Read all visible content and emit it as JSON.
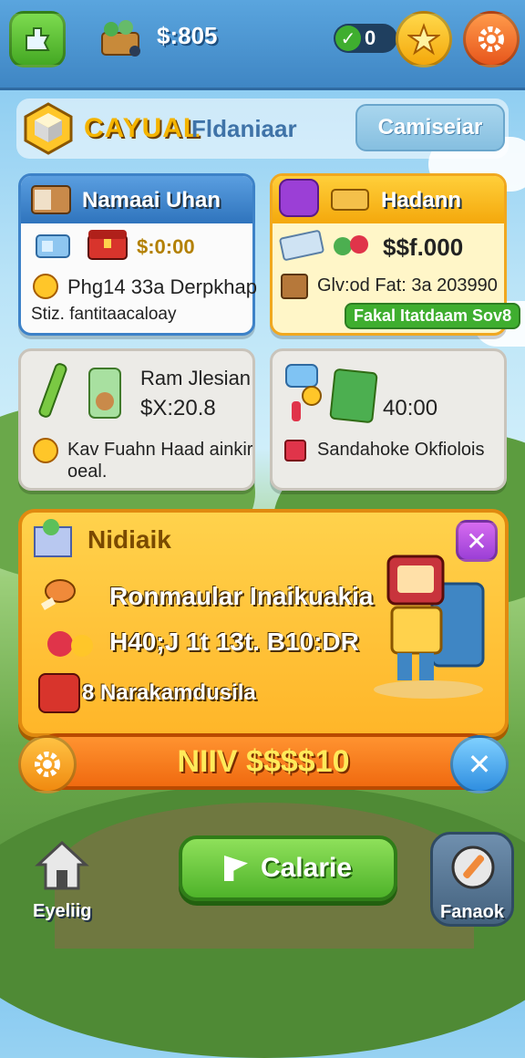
{
  "top_bar": {
    "currency": "$:805",
    "counter": "0"
  },
  "header": {
    "title": "CAYUAL",
    "subtitle": "Fldaniaar",
    "action_label": "Camiseiar"
  },
  "cards": [
    {
      "title": "Namaai Uhan",
      "value": "$:0:00",
      "line1": "Phg14 33a Derpkhap",
      "line2": "Stiz. fantitaacaloay"
    },
    {
      "title": "Hadann",
      "value": "$$f.000",
      "line1": "Glv:od Fat: 3a 203990",
      "tag": "Fakal Itatdaam Sov8"
    },
    {
      "title": "Ram Jlesian",
      "value": "$X:20.8",
      "line1": "Kav Fuahn Haad ainkir",
      "line2": "oeal."
    },
    {
      "title": "",
      "value": "40:00",
      "line1": "Sandahoke Okfiolois"
    }
  ],
  "promo": {
    "title": "Nidiaik",
    "lines": [
      "Ronmaular Inaikuakia",
      "H40;J 1t 13t. B10:DR",
      "8 Narakamdusila"
    ],
    "buy_label": "NIIV $$$$10"
  },
  "bottom_nav": {
    "left_label": "Eyeliig",
    "center_label": "Calarie",
    "right_label": "Fanaok"
  },
  "colors": {
    "top_bar": "#3f86c4",
    "accent_yellow": "#ffc629",
    "accent_orange": "#f06a10",
    "accent_green": "#4fb32a",
    "card_blue_border": "#3d82c8"
  },
  "icons": [
    "star-icon",
    "gear-icon",
    "close-icon",
    "home-icon",
    "pencil-icon",
    "check-icon"
  ]
}
